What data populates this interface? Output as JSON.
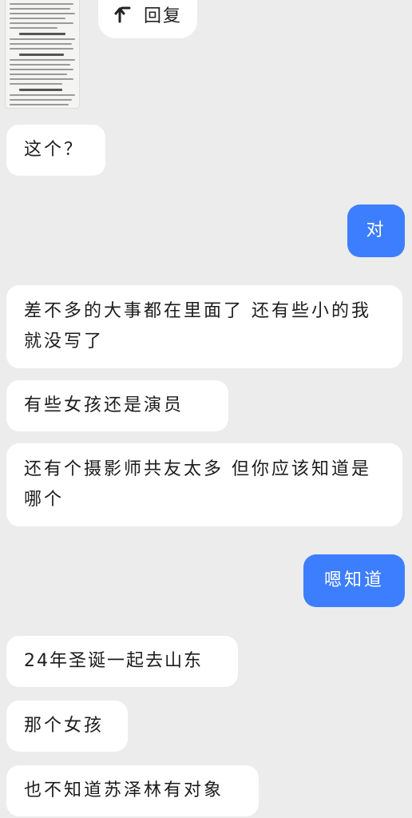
{
  "reply": {
    "label": "回复",
    "icon": "reply-arrow-icon"
  },
  "messages": [
    {
      "side": "in",
      "text": "这个？"
    },
    {
      "side": "out",
      "text": "对"
    },
    {
      "side": "in",
      "text": "差不多的大事都在里面了  还有些小的我就没写了"
    },
    {
      "side": "in",
      "text": "有些女孩还是演员"
    },
    {
      "side": "in",
      "text": "还有个摄影师共友太多  但你应该知道是哪个"
    },
    {
      "side": "out",
      "text": "嗯知道"
    },
    {
      "side": "in",
      "text": "24年圣诞一起去山东"
    },
    {
      "side": "in",
      "text": "那个女孩"
    },
    {
      "side": "in",
      "text": "也不知道苏泽林有对象"
    }
  ],
  "colors": {
    "background": "#ececec",
    "incoming_bubble": "#ffffff",
    "outgoing_bubble": "#3d7eff"
  }
}
